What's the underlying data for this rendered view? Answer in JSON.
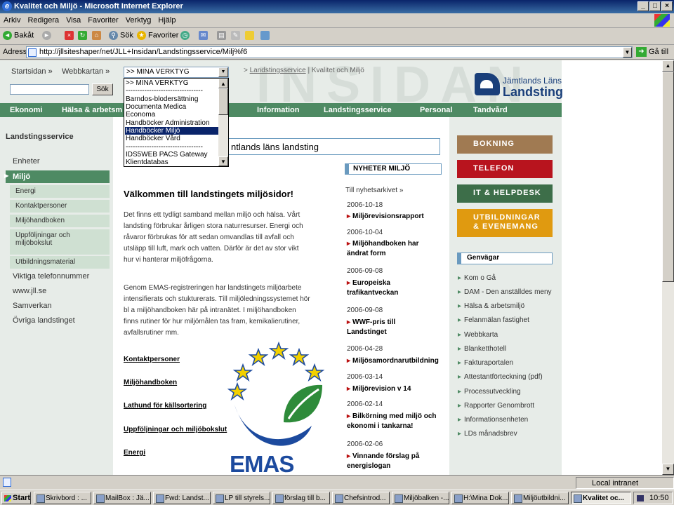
{
  "window": {
    "title": "Kvalitet och Miljö - Microsoft Internet Explorer"
  },
  "menubar": [
    "Arkiv",
    "Redigera",
    "Visa",
    "Favoriter",
    "Verktyg",
    "Hjälp"
  ],
  "toolbar": {
    "back": "Bakåt",
    "search": "Sök",
    "favorites": "Favoriter"
  },
  "address": {
    "label": "Adress",
    "url": "http://jllsiteshaper/net/JLL+Insidan/Landstingsservice/Milj%f6",
    "go": "Gå till"
  },
  "site": {
    "bigword": "INSIDAN",
    "startsidan": "Startsidan »",
    "webbkartan": "Webbkartan »",
    "select_value": ">> MINA VERKTYG",
    "search_button": "Sök",
    "breadcrumb_link": "Landstingsservice",
    "breadcrumb_current": "Kvalitet och Miljö",
    "logo_line1": "Jämtlands Läns",
    "logo_line2": "Landsting"
  },
  "dropdown_options": [
    ">> MINA VERKTYG",
    "---------------------------------",
    "Barndos-blodersättning",
    "Documenta Medica",
    "Economa",
    "Handböcker Administration",
    "Handböcker Miljö",
    "Handböcker Vård",
    "---------------------------------",
    "IDS5WEB PACS Gateway",
    "Klientdatabas"
  ],
  "nav": [
    "Ekonomi",
    "Hälsa & arbetsm",
    "Information",
    "Landstingsservice",
    "Personal",
    "Tandvård"
  ],
  "left": {
    "heading": "Landstingsservice",
    "enheter": "Enheter",
    "active": "Miljö",
    "subs": [
      "Energi",
      "Kontaktpersoner",
      "Miljöhandboken",
      "Uppföljningar och",
      "miljöbokslut",
      "Utbildningsmaterial"
    ],
    "links": [
      "Viktiga telefonnummer",
      "www.jll.se",
      "Samverkan",
      "Övriga landstinget"
    ]
  },
  "center": {
    "title_tail": "ntlands läns landsting",
    "welcome": "Välkommen till landstingets miljösidor!",
    "para1": [
      "Det finns ett tydligt samband mellan miljö och hälsa. Vårt",
      "landsting förbrukar årligen stora naturresurser. Energi och",
      "råvaror förbrukas för att sedan omvandlas till avfall och",
      "utsläpp till luft, mark och vatten. Därför är det av stor vikt",
      "hur vi hanterar miljöfrågorna."
    ],
    "para2": [
      "Genom EMAS-registreringen har landstingets miljöarbete",
      "intensifierats och stukturerats. Till miljöledningssystemet hör",
      "bl a miljöhandboken här på intranätet. I miljöhandboken",
      "finns rutiner för hur miljömålen tas fram, kemikalierutiner,",
      "avfallsrutiner mm."
    ],
    "links": [
      "Kontaktpersoner",
      "Miljöhandboken",
      "Lathund för källsortering",
      "Uppföljningar och miljöbokslut",
      "Energi"
    ],
    "emas": "EMAS"
  },
  "news": {
    "heading": "NYHETER MILJÖ",
    "archive": "Till nyhetsarkivet »",
    "items": [
      {
        "date": "2006-10-18",
        "text": "Miljörevisionsrapport"
      },
      {
        "date": "2006-10-04",
        "text": "Miljöhandboken har ändrat form"
      },
      {
        "date": "2006-09-08",
        "text": "Europeiska trafikantveckan"
      },
      {
        "date": "2006-09-08",
        "text": "WWF-pris till Landstinget"
      },
      {
        "date": "2006-04-28",
        "text": "Miljösamordnarutbildning"
      },
      {
        "date": "2006-03-14",
        "text": "Miljörevision v 14"
      },
      {
        "date": "2006-02-14",
        "text": "Bilkörning med miljö och ekonomi i tankarna!"
      },
      {
        "date": "2006-02-06",
        "text": "Vinnande förslag på energislogan"
      }
    ]
  },
  "right": {
    "boxes": [
      "BOKNING",
      "TELEFON",
      "IT & HELPDESK",
      "UTBILDNINGAR",
      "& EVENEMANG"
    ],
    "box_colors": [
      "#a07a52",
      "#b8141e",
      "#3d6e49",
      "#e09a10"
    ],
    "genvag": "Genvägar",
    "links": [
      "Kom o Gå",
      "DAM - Den anställdes meny",
      "Hälsa & arbetsmiljö",
      "Felanmälan fastighet",
      "Webbkarta",
      "Blanketthotell",
      "Fakturaportalen",
      "Attestantförteckning (pdf)",
      "Processutveckling",
      "Rapporter Genombrott",
      "Informationsenheten",
      "LDs månadsbrev"
    ]
  },
  "status": {
    "zone": "Local intranet"
  },
  "taskbar": {
    "start": "Start",
    "tasks": [
      "Skrivbord : ...",
      "MailBox : Jä...",
      "Fwd: Landst...",
      "LP till styrels...",
      "förslag till b...",
      "Chefsintrod...",
      "Miljöbalken -...",
      "H:\\Mina Dok...",
      "Miljöutbildni...",
      "Kvalitet oc..."
    ],
    "clock": "10:50"
  }
}
